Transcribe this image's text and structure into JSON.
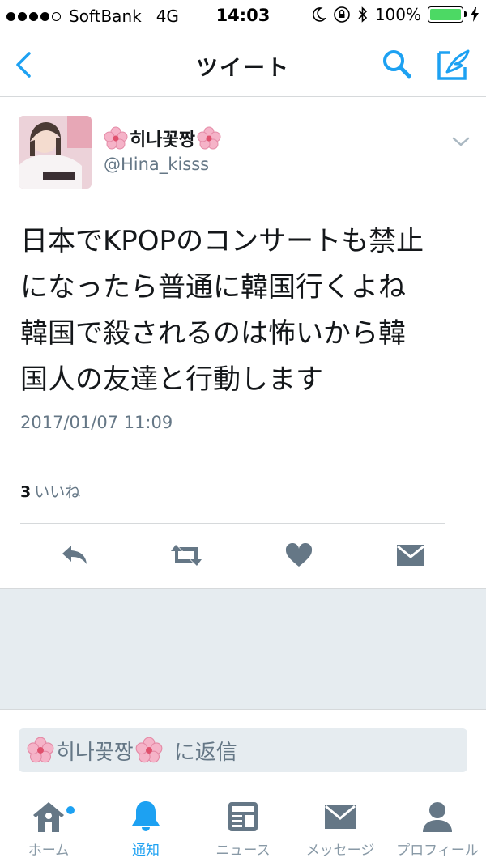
{
  "status_bar": {
    "carrier": "SoftBank",
    "network": "4G",
    "time": "14:03",
    "battery": "100%",
    "battery_level": 1.0
  },
  "nav": {
    "title": "ツイート"
  },
  "tweet": {
    "display_name": "히나꽃짱",
    "handle": "@Hina_kisss",
    "text": "日本でKPOPのコンサートも禁止\nになったら普通に韓国行くよね\n韓国で殺されるのは怖いから韓\n国人の友達と行動します",
    "timestamp": "2017/01/07 11:09",
    "likes_count": "3",
    "likes_label": "いいね"
  },
  "reply": {
    "name": "히나꽃짱",
    "suffix": "に返信"
  },
  "tabs": [
    {
      "label": "ホーム",
      "icon": "home-icon"
    },
    {
      "label": "通知",
      "icon": "bell-icon"
    },
    {
      "label": "ニュース",
      "icon": "news-icon"
    },
    {
      "label": "メッセージ",
      "icon": "message-icon"
    },
    {
      "label": "プロフィール",
      "icon": "profile-icon"
    }
  ],
  "colors": {
    "accent": "#1da1f2",
    "icon_gray": "#657786",
    "background_gray": "#e6ecf0",
    "battery_green": "#4cd964"
  }
}
